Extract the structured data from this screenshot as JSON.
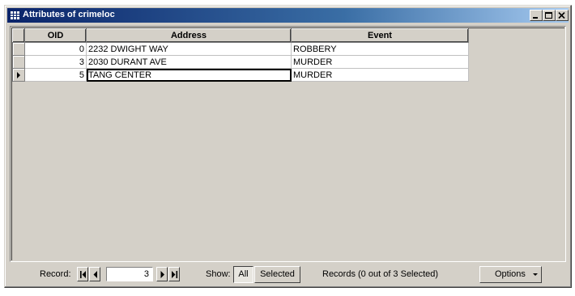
{
  "window": {
    "title": "Attributes of crimeloc",
    "icon": "table-icon",
    "controls": {
      "minimize": "minimize-icon",
      "maximize": "maximize-icon",
      "close": "close-icon"
    }
  },
  "table": {
    "columns": [
      "OID",
      "Address",
      "Event"
    ],
    "rows": [
      {
        "oid": "0",
        "address": "2232 DWIGHT WAY",
        "event": "ROBBERY"
      },
      {
        "oid": "3",
        "address": "2030 DURANT AVE",
        "event": "MURDER"
      },
      {
        "oid": "5",
        "address": "TANG CENTER",
        "event": "MURDER",
        "current": true
      }
    ]
  },
  "statusbar": {
    "record_label": "Record:",
    "record_value": "3",
    "show_label": "Show:",
    "all_label": "All",
    "selected_label": "Selected",
    "records_text": "Records (0 out of 3 Selected)",
    "options_label": "Options"
  }
}
